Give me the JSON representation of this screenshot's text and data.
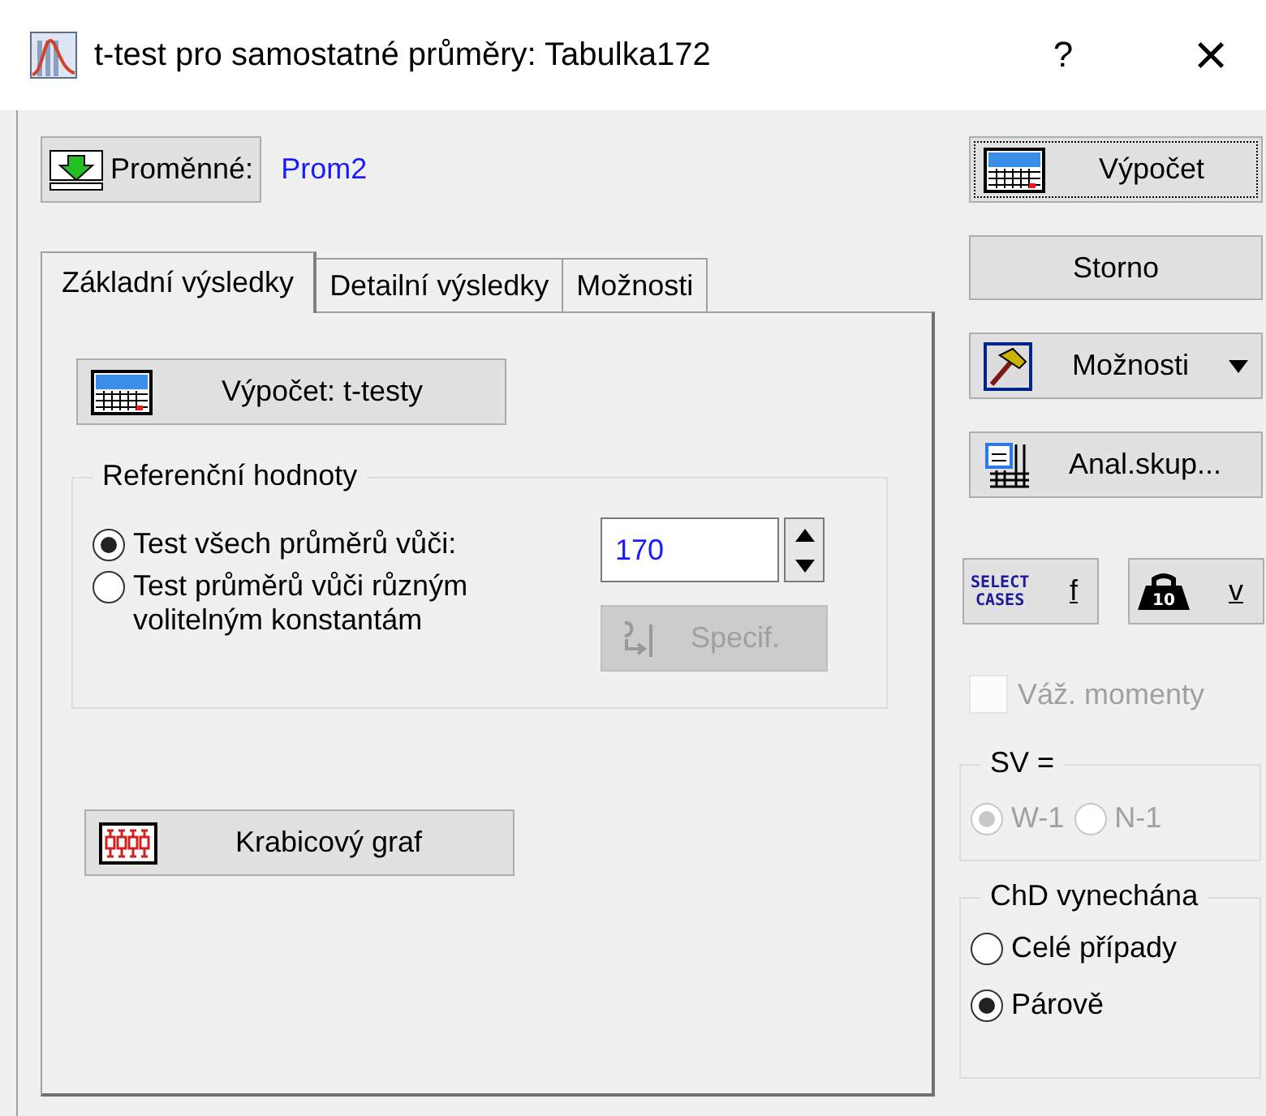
{
  "window": {
    "title": "t-test pro samostatné průměry: Tabulka172",
    "help": "?",
    "close": "×"
  },
  "variables": {
    "button": "Proměnné:",
    "value": "Prom2"
  },
  "tabs": [
    {
      "label": "Základní výsledky",
      "selected": true
    },
    {
      "label": "Detailní výsledky",
      "selected": false
    },
    {
      "label": "Možnosti",
      "selected": false
    }
  ],
  "tab_panel": {
    "compute_button": "Výpočet: t-testy",
    "reference": {
      "title": "Referenční hodnoty",
      "options": [
        {
          "label": "Test všech průměrů vůči:",
          "selected": true
        },
        {
          "label": "Test průměrů vůči různým volitelným konstantám",
          "selected": false
        }
      ],
      "value": "170",
      "specify_button": {
        "label": "Specif.",
        "disabled": true
      }
    },
    "boxplot_button": "Krabicový graf"
  },
  "side": {
    "compute_button": "Výpočet",
    "cancel_button": "Storno",
    "options_button": "Možnosti",
    "by_group_button": "Anal.skup...",
    "select_cases": {
      "icon_text": [
        "SELECT",
        "CASES"
      ],
      "label": "f"
    },
    "weight": {
      "icon_text": "10",
      "label": "v"
    },
    "weighted_moments": {
      "label": "Váž. momenty",
      "checked": false,
      "disabled": true
    },
    "df": {
      "title": "SV =",
      "options": [
        {
          "label": "W-1",
          "selected": true,
          "disabled": true
        },
        {
          "label": "N-1",
          "selected": false,
          "disabled": true
        }
      ]
    },
    "missing": {
      "title": "ChD vynechána",
      "options": [
        {
          "label": "Celé případy",
          "selected": false,
          "disabled": false
        },
        {
          "label": "Párově",
          "selected": true,
          "disabled": false
        }
      ]
    }
  }
}
